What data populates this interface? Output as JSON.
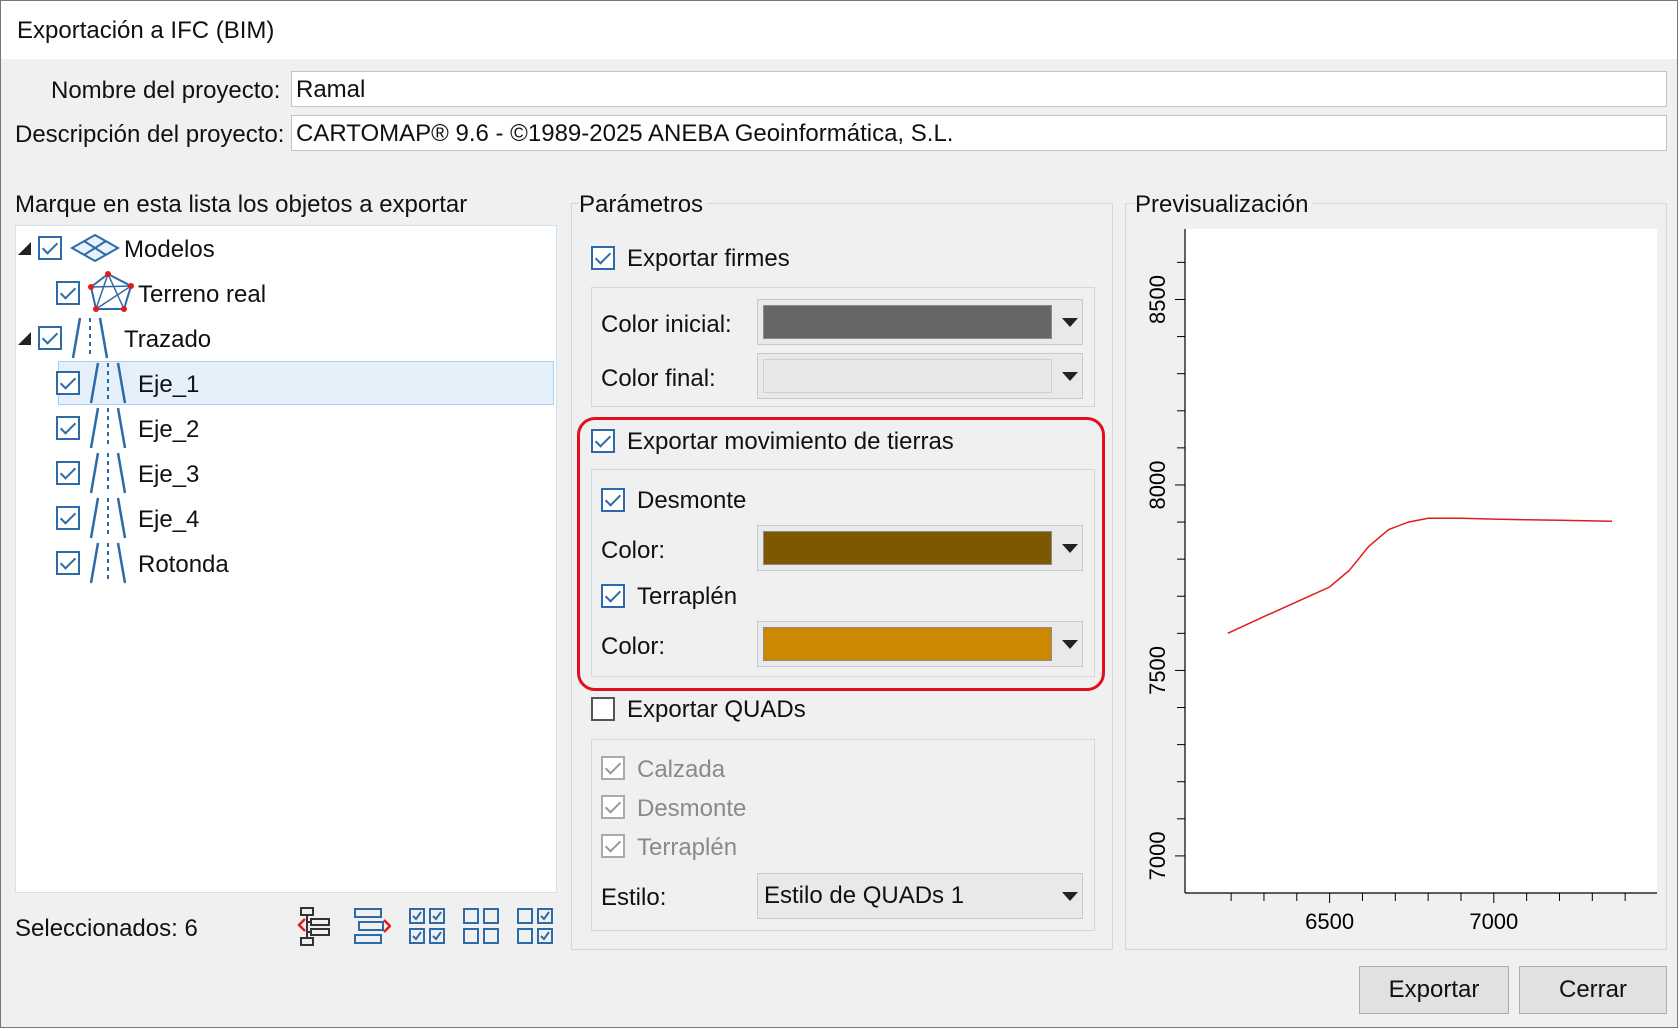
{
  "window": {
    "title": "Exportación a IFC (BIM)"
  },
  "project": {
    "name_label": "Nombre del proyecto:",
    "name_value": "Ramal",
    "desc_label": "Descripción del proyecto:",
    "desc_value": "CARTOMAP® 9.6 - ©1989-2025 ANEBA Geoinformática, S.L."
  },
  "tree": {
    "title": "Marque en esta lista los objetos a exportar",
    "items": [
      {
        "label": "Modelos",
        "checked": true,
        "icon": "models-icon",
        "level": 0,
        "expanded": true
      },
      {
        "label": "Terreno real",
        "checked": true,
        "icon": "terrain-icon",
        "level": 1
      },
      {
        "label": "Trazado",
        "checked": true,
        "icon": "road-icon",
        "level": 0,
        "expanded": true
      },
      {
        "label": "Eje_1",
        "checked": true,
        "icon": "road-icon",
        "level": 1,
        "selected": true
      },
      {
        "label": "Eje_2",
        "checked": true,
        "icon": "road-icon",
        "level": 1
      },
      {
        "label": "Eje_3",
        "checked": true,
        "icon": "road-icon",
        "level": 1
      },
      {
        "label": "Eje_4",
        "checked": true,
        "icon": "road-icon",
        "level": 1
      },
      {
        "label": "Rotonda",
        "checked": true,
        "icon": "road-icon",
        "level": 1
      }
    ],
    "selected_count": "Seleccionados: 6",
    "toolbar_icons": [
      "expand-all-icon",
      "collapse-all-icon",
      "check-all-icon",
      "uncheck-all-icon",
      "invert-check-icon"
    ]
  },
  "params": {
    "title": "Parámetros",
    "export_pavements": {
      "label": "Exportar firmes",
      "checked": true
    },
    "initial_color_label": "Color inicial:",
    "initial_color": "#666666",
    "final_color_label": "Color final:",
    "final_color": "#e8e8e8",
    "export_earthworks": {
      "label": "Exportar movimiento de tierras",
      "checked": true
    },
    "cut": {
      "label": "Desmonte",
      "checked": true,
      "color_label": "Color:",
      "color": "#7d5800"
    },
    "fill": {
      "label": "Terraplén",
      "checked": true,
      "color_label": "Color:",
      "color": "#cc8800"
    },
    "export_quads": {
      "label": "Exportar QUADs",
      "checked": false
    },
    "quads_items": [
      {
        "label": "Calzada",
        "checked": true
      },
      {
        "label": "Desmonte",
        "checked": true
      },
      {
        "label": "Terraplén",
        "checked": true
      }
    ],
    "style_label": "Estilo:",
    "style_value": "Estilo de QUADs 1"
  },
  "preview": {
    "title": "Previsualización",
    "line_color": "#e21b1b"
  },
  "chart_data": {
    "type": "line",
    "title": "",
    "xlabel": "",
    "ylabel": "",
    "x_ticks": [
      "6500",
      "7000"
    ],
    "y_ticks": [
      "8500",
      "8000",
      "7500",
      "7000"
    ],
    "xlim": [
      6090,
      7430
    ],
    "ylim": [
      6900,
      8690
    ],
    "grid": false,
    "series": [
      {
        "x": [
          6190,
          6300,
          6400,
          6500,
          6560,
          6620,
          6680,
          6740,
          6800,
          6900,
          7000,
          7100,
          7200,
          7300,
          7360
        ],
        "y": [
          7600,
          7645,
          7685,
          7725,
          7770,
          7835,
          7880,
          7900,
          7910,
          7910,
          7908,
          7906,
          7905,
          7903,
          7902
        ]
      }
    ]
  },
  "buttons": {
    "export": "Exportar",
    "close": "Cerrar"
  }
}
